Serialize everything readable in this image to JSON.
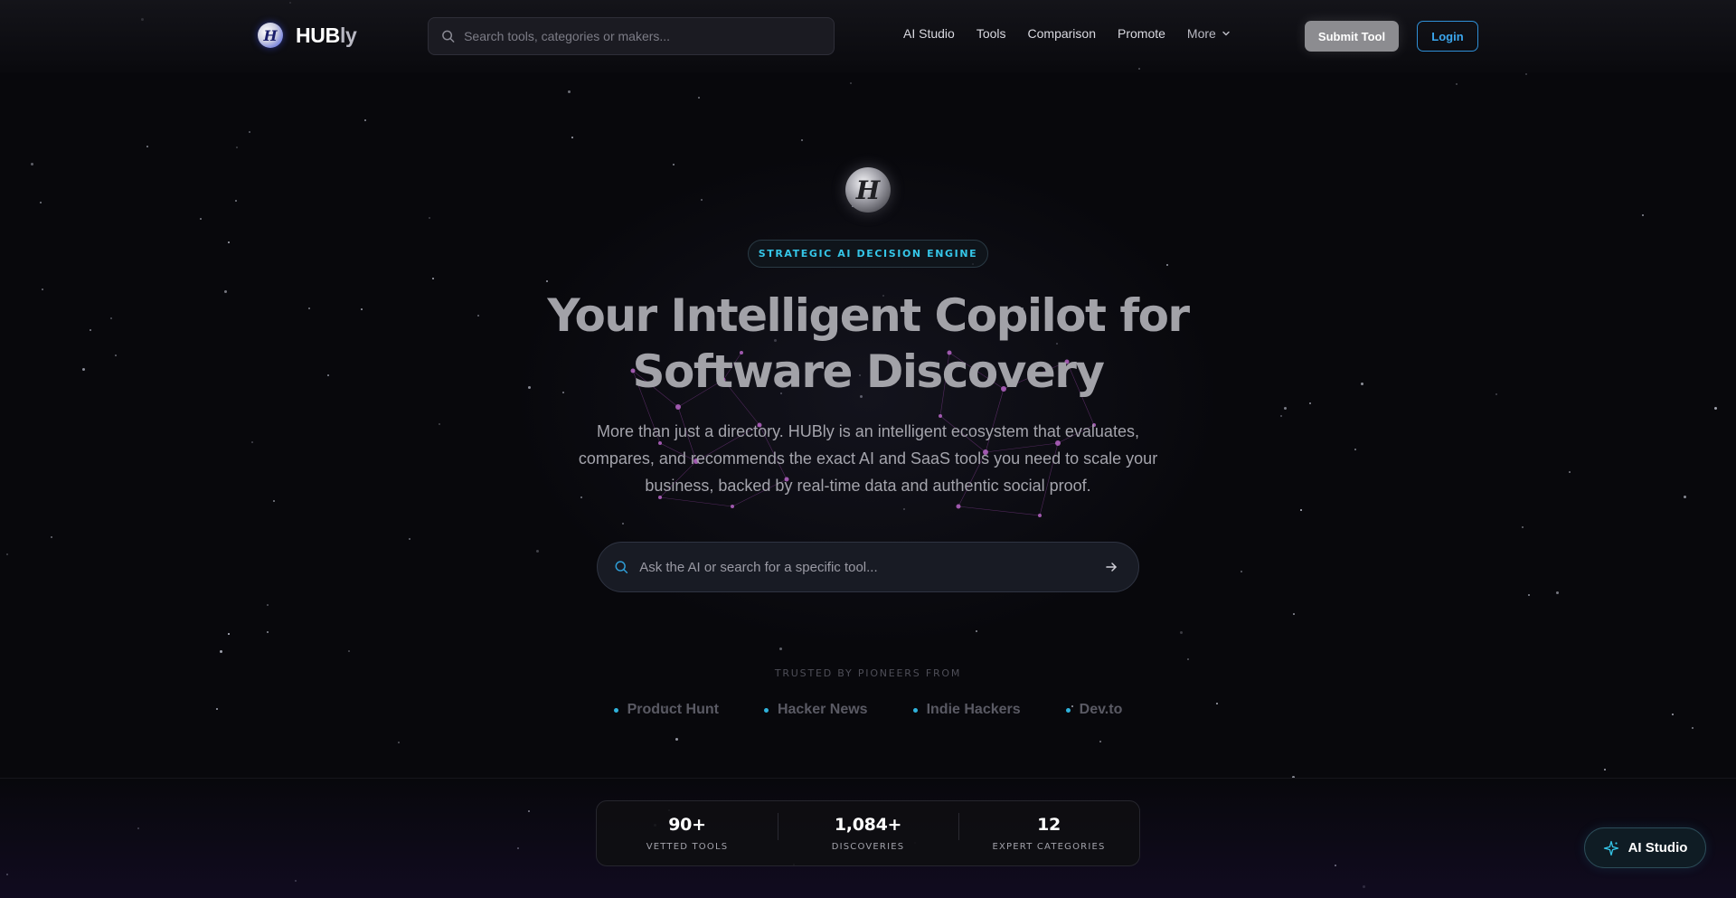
{
  "colors": {
    "background": "#08080c",
    "accent_cyan": "#35c6e8",
    "accent_blue": "#3ba7ee",
    "network_purple": "#b060c0"
  },
  "nav": {
    "brand": {
      "name_main": "HUB",
      "name_dim": "ly",
      "logo_icon": "hubly-logo-icon"
    },
    "search": {
      "placeholder": "Search tools, categories or makers...",
      "icon": "search-icon"
    },
    "links": [
      "AI Studio",
      "Tools",
      "Comparison",
      "Promote"
    ],
    "more_label": "More",
    "submit_label": "Submit Tool",
    "login_label": "Login"
  },
  "hero": {
    "logo_icon": "hubly-logo-icon",
    "badge": "STRATEGIC AI DECISION ENGINE",
    "title_line1": "Your Intelligent Copilot for",
    "title_line2": "Software Discovery",
    "subtitle": "More than just a directory. HUBly is an intelligent ecosystem that evaluates, compares, and recommends the exact AI and SaaS tools you need to scale your business, backed by real-time data and authentic social proof.",
    "search": {
      "placeholder": "Ask the AI or search for a specific tool...",
      "icon": "search-icon",
      "submit_icon": "arrow-right-icon"
    }
  },
  "trusted": {
    "label": "TRUSTED BY PIONEERS FROM",
    "items": [
      "Product Hunt",
      "Hacker News",
      "Indie Hackers",
      "Dev.to"
    ]
  },
  "stats": [
    {
      "value": "90+",
      "label": "VETTED TOOLS"
    },
    {
      "value": "1,084+",
      "label": "DISCOVERIES"
    },
    {
      "value": "12",
      "label": "EXPERT CATEGORIES"
    }
  ],
  "fab": {
    "label": "AI Studio",
    "icon": "sparkle-icon"
  }
}
